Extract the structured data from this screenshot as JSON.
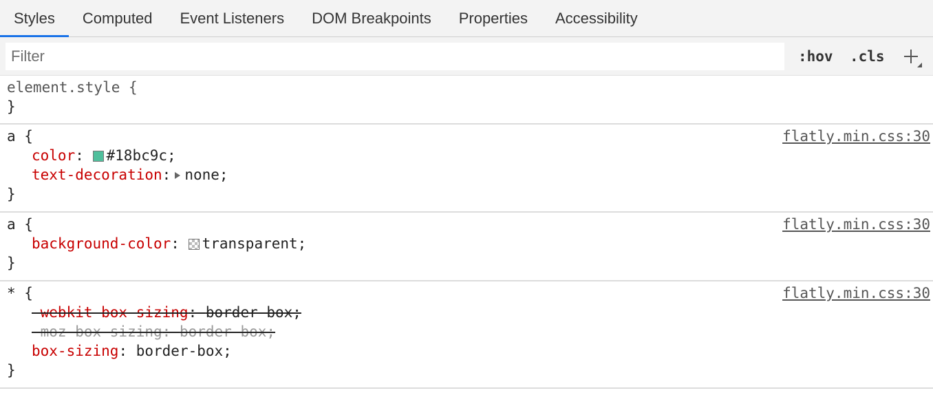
{
  "tabs": [
    {
      "label": "Styles",
      "active": true
    },
    {
      "label": "Computed"
    },
    {
      "label": "Event Listeners"
    },
    {
      "label": "DOM Breakpoints"
    },
    {
      "label": "Properties"
    },
    {
      "label": "Accessibility"
    }
  ],
  "filter": {
    "placeholder": "Filter",
    "value": ""
  },
  "toolbar": {
    "hov_label": ":hov",
    "cls_label": ".cls",
    "add_icon": "plus-icon"
  },
  "rules": {
    "element_style": {
      "selector": "element.style {",
      "close": "}"
    },
    "a_color": {
      "selector": "a",
      "open": " {",
      "close": "}",
      "source": "flatly.min.css:30",
      "decls": [
        {
          "prop": "color",
          "sep": ": ",
          "value": "#18bc9c;",
          "swatch": "#18bc9c"
        },
        {
          "prop": "text-decoration",
          "sep": ":",
          "value": "none;"
        }
      ]
    },
    "a_bg": {
      "selector": "a",
      "open": " {",
      "close": "}",
      "source": "flatly.min.css:30",
      "decls": [
        {
          "prop": "background-color",
          "sep": ": ",
          "value": "transparent;"
        }
      ]
    },
    "universal": {
      "selector": "*",
      "open": " {",
      "close": "}",
      "source": "flatly.min.css:30",
      "decls": [
        {
          "prop": "-webkit-box-sizing",
          "sep": ": ",
          "value": "border-box;",
          "overridden": true
        },
        {
          "prop": "-moz-box-sizing",
          "sep": ": ",
          "value": "border-box;",
          "overridden": true,
          "invalid": true
        },
        {
          "prop": "box-sizing",
          "sep": ": ",
          "value": "border-box;"
        }
      ]
    }
  },
  "colors": {
    "accent_tab": "#1a73e8",
    "property": "#c80000",
    "swatch_teal": "#18bc9c"
  }
}
